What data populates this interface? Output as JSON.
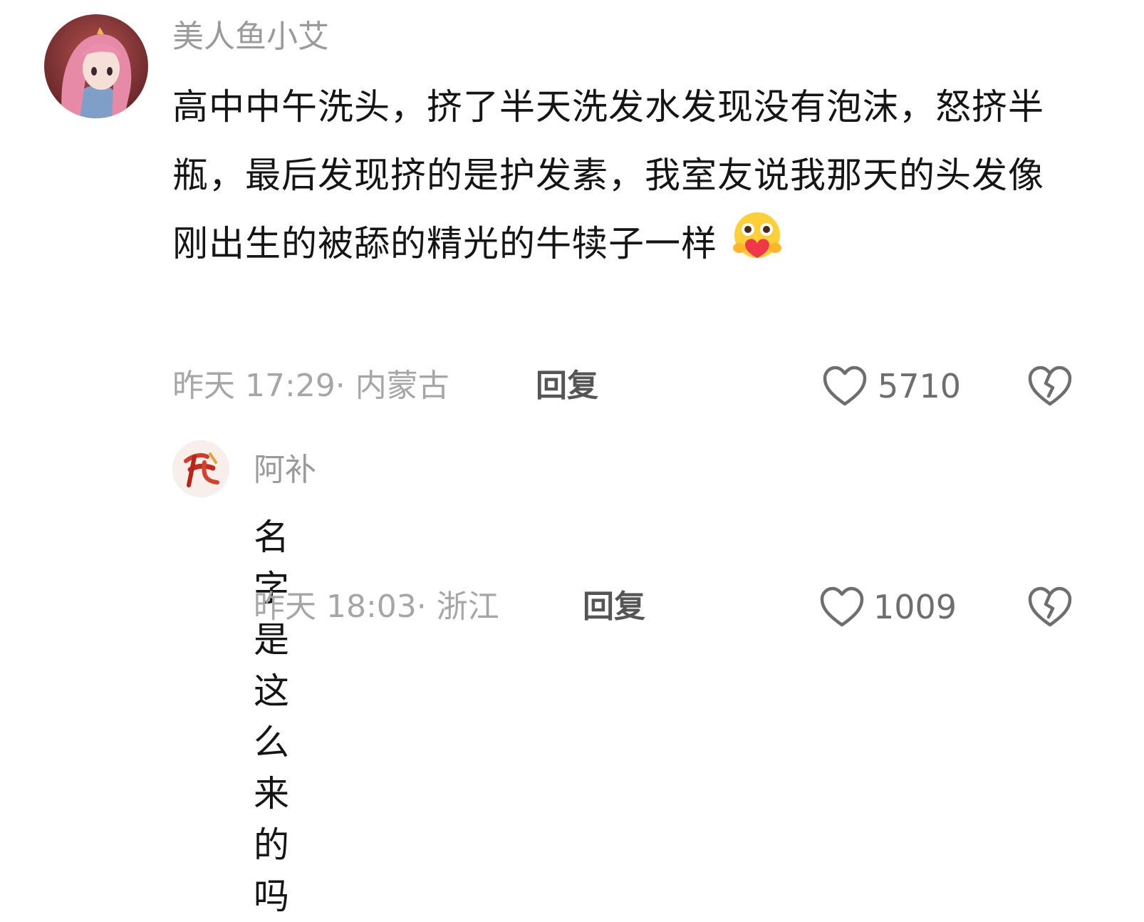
{
  "comments": [
    {
      "username": "美人鱼小艾",
      "content": "高中中午洗头，挤了半天洗发水发现没有泡沫，怒挤半瓶，最后发现挤的是护发素，我室友说我那天的头发像刚出生的被舔的精光的牛犊子一样",
      "emoji": "hug-heart-emoji",
      "time": "昨天 17:29",
      "location": "内蒙古",
      "reply_label": "回复",
      "likes": "5710",
      "avatar": "anime-girl-pink-hair-avatar"
    },
    {
      "username": "阿补",
      "content": "名字是这么来的吗",
      "time": "昨天 18:03",
      "location": "浙江",
      "reply_label": "回复",
      "likes": "1009",
      "avatar": "red-calligraphy-logo-avatar"
    }
  ],
  "colors": {
    "username": "#9a9a9a",
    "text": "#151515",
    "meta": "#a6a6a6",
    "icon": "#6e6e6e"
  }
}
